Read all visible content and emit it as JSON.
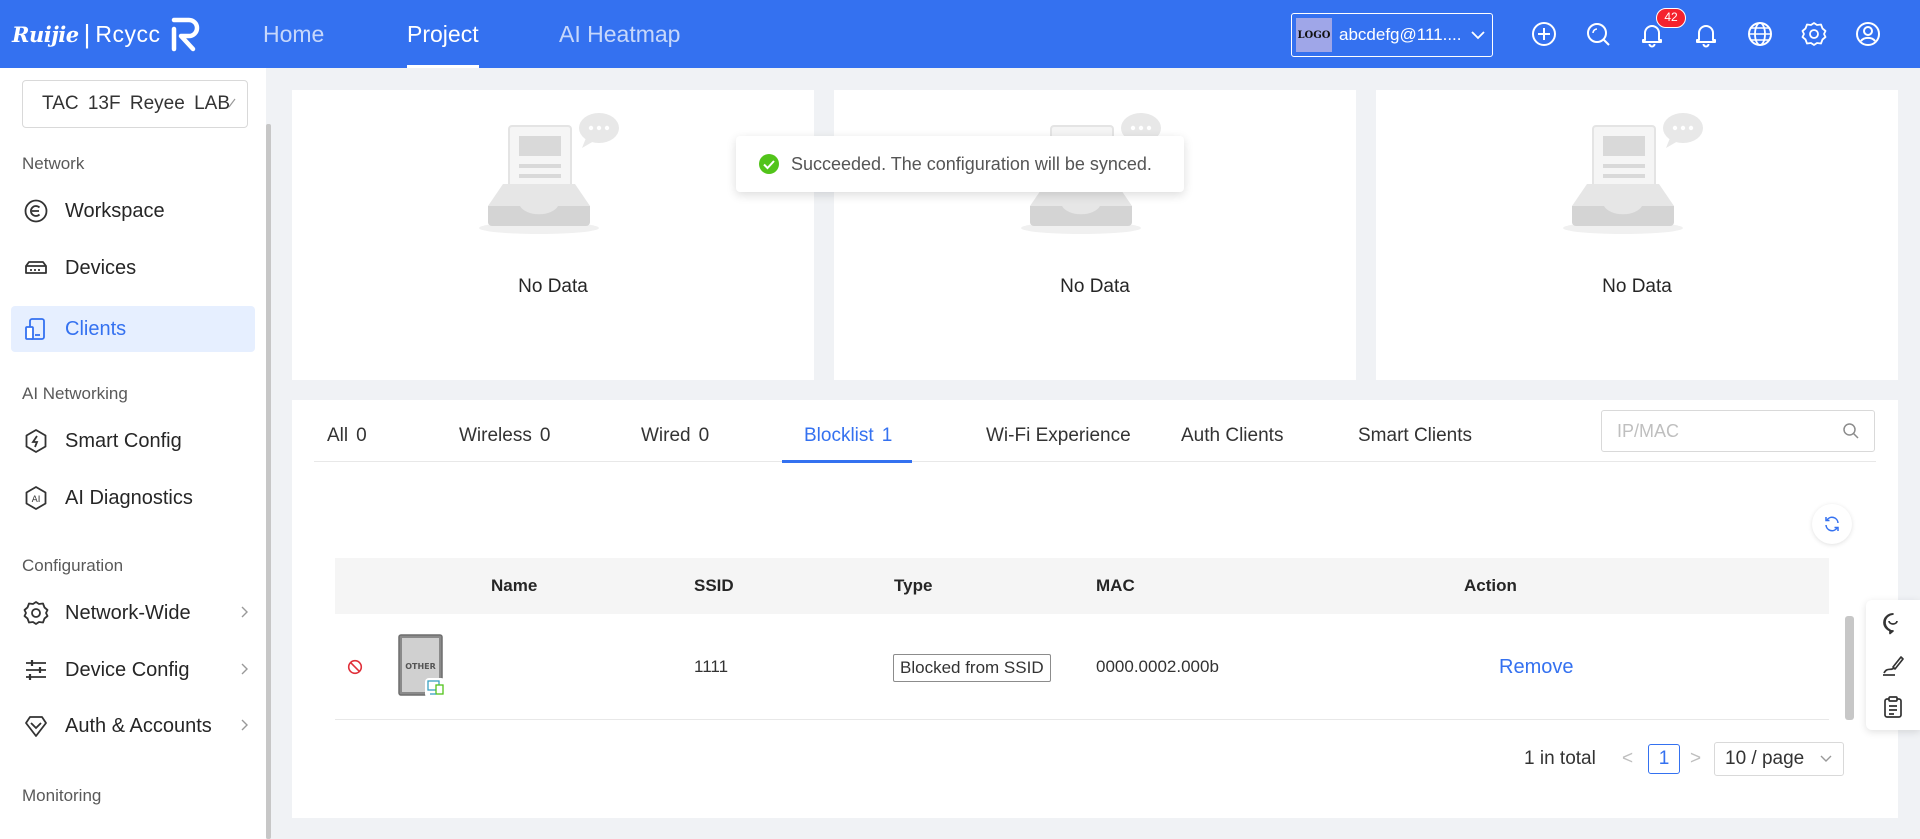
{
  "header": {
    "brand_ruijie": "Ruijie",
    "brand_sep": "|",
    "brand_reyee": "Rcycc",
    "nav": [
      {
        "label": "Home",
        "active": false
      },
      {
        "label": "Project",
        "active": true
      },
      {
        "label": "AI Heatmap",
        "active": false
      }
    ],
    "account_logo": "LOGO",
    "account_name": "abcdefg@111....",
    "notification_count": "42",
    "icons": [
      "plus-circle-icon",
      "search-icon",
      "notification-bell-icon",
      "alarm-bell-icon",
      "globe-icon",
      "settings-gear-icon",
      "user-icon"
    ]
  },
  "sidebar": {
    "project": "TAC 13F Reyee LAB",
    "groups": {
      "network": "Network",
      "ai": "AI Networking",
      "config": "Configuration",
      "monitoring": "Monitoring"
    },
    "items": {
      "workspace": "Workspace",
      "devices": "Devices",
      "clients": "Clients",
      "smart_config": "Smart Config",
      "ai_diagnostics": "AI Diagnostics",
      "network_wide": "Network-Wide",
      "device_config": "Device Config",
      "auth_accounts": "Auth & Accounts"
    },
    "active_item": "Clients"
  },
  "cards": [
    {
      "empty_text": "No Data"
    },
    {
      "empty_text": "No Data"
    },
    {
      "empty_text": "No Data"
    }
  ],
  "toast": {
    "message": "Succeeded. The configuration will be synced.",
    "color": "#52c41a"
  },
  "tabs": [
    {
      "label": "All",
      "count": "0"
    },
    {
      "label": "Wireless",
      "count": "0"
    },
    {
      "label": "Wired",
      "count": "0"
    },
    {
      "label": "Blocklist",
      "count": "1",
      "active": true
    },
    {
      "label": "Wi-Fi Experience",
      "count": ""
    },
    {
      "label": "Auth Clients",
      "count": ""
    },
    {
      "label": "Smart Clients",
      "count": ""
    }
  ],
  "search": {
    "placeholder": "IP/MAC",
    "value": ""
  },
  "table": {
    "columns": {
      "name": "Name",
      "ssid": "SSID",
      "type": "Type",
      "mac": "MAC",
      "action": "Action"
    },
    "rows": [
      {
        "device_label": "OTHER",
        "name": "",
        "ssid": "1111",
        "type": "Blocked from SSID",
        "mac": "0000.0002.000b",
        "action": "Remove"
      }
    ]
  },
  "pagination": {
    "total": "1 in total",
    "prev": "<",
    "current": "1",
    "next": ">",
    "page_size": "10 / page"
  },
  "colors": {
    "primary": "#3471f0",
    "blocked_red": "#e0303a"
  }
}
